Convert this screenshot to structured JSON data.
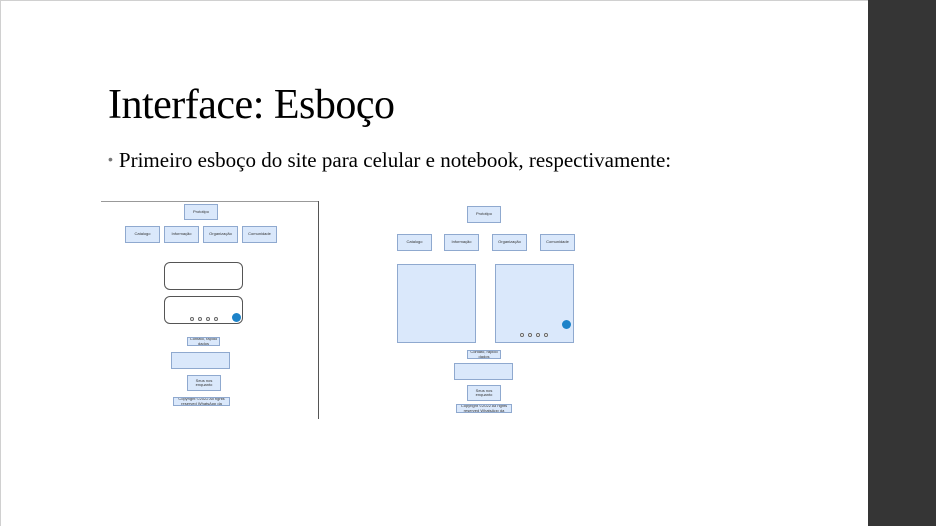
{
  "slide": {
    "title": "Interface: Esboço",
    "bullet": "Primeiro esboço do site para celular e notebook, respectivamente:"
  },
  "mobile_sketch": {
    "header": "Prototipo",
    "nav": [
      "Catalogo",
      "Informação",
      "Organização",
      "Comunidade"
    ],
    "contact_label": "Contato, rapido dados",
    "social_label": "Seus nos enquanto",
    "footer": "Copyright ©2022 All rights reserved WhatsApp da"
  },
  "notebook_sketch": {
    "header": "Prototipo",
    "nav": [
      "Catalogo",
      "Informação",
      "Organização",
      "Comunidade"
    ],
    "contact_label": "Contato, rapido dados",
    "social_label": "Seus nos enquanto",
    "footer": "Copyright ©2022 All rights reserved WhatsApp da"
  },
  "colors": {
    "box_fill": "#dae8fb",
    "box_border": "#8fa9cf",
    "fab": "#1d83c9",
    "side_panel": "#353535"
  }
}
